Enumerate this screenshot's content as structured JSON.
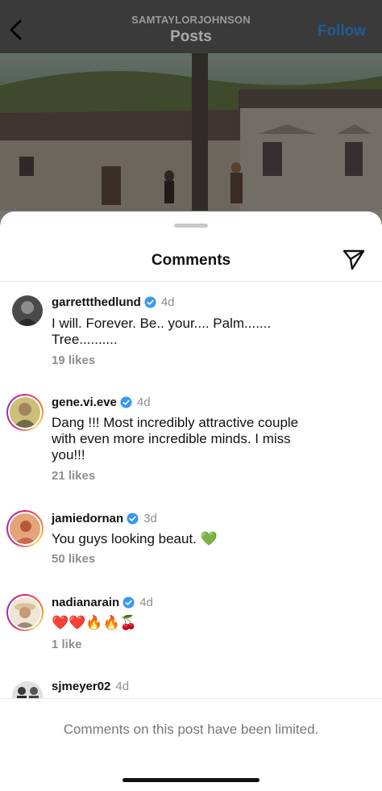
{
  "post_header": {
    "username": "SAMTAYLORJOHNSON",
    "title": "Posts",
    "follow_label": "Follow"
  },
  "sheet": {
    "title": "Comments",
    "footer_note": "Comments on this post have been limited."
  },
  "comments": [
    {
      "username": "garrettthedlund",
      "age": "4d",
      "text": "I  will.  Forever.  Be.. your.... Palm....... Tree..........",
      "likes": "19 likes"
    },
    {
      "username": "gene.vi.eve",
      "age": "4d",
      "text": "Dang !!! Most incredibly attractive couple with even more incredible minds. I miss you!!!",
      "likes": "21 likes"
    },
    {
      "username": "jamiedornan",
      "age": "3d",
      "text": "You guys looking beaut. 💚",
      "likes": "50 likes"
    },
    {
      "username": "nadianarain",
      "age": "4d",
      "text": "❤️❤️🔥🔥🍒",
      "likes": "1 like"
    },
    {
      "username": "sjmeyer02",
      "age": "4d"
    }
  ],
  "icons": {
    "back": "chevron-left-icon",
    "share": "paper-plane-icon",
    "verified": "verified-badge-icon"
  },
  "colors": {
    "accent_blue": "#0095f6",
    "verified_blue": "#3897f0",
    "muted_gray": "#8e8e8e"
  }
}
